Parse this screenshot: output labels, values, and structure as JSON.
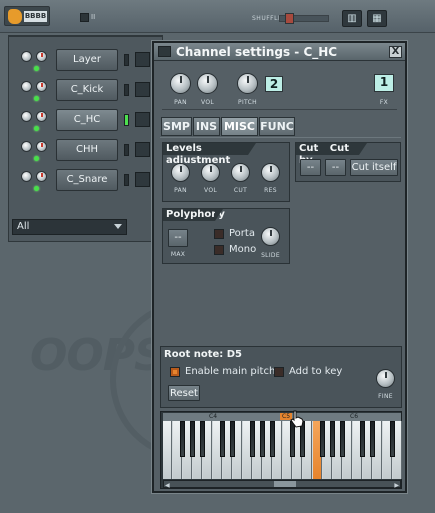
{
  "topbar": {
    "logo_lcd": "BBBB",
    "small_text": "II",
    "shuffle_label": "SHUFFLE"
  },
  "rack": {
    "channels": [
      {
        "label": "Layer",
        "selected": false,
        "led": false
      },
      {
        "label": "C_Kick",
        "selected": false,
        "led": false
      },
      {
        "label": "C_HC",
        "selected": true,
        "led": true
      },
      {
        "label": "CHH",
        "selected": false,
        "led": false
      },
      {
        "label": "C_Snare",
        "selected": false,
        "led": false
      }
    ],
    "filter_value": "All"
  },
  "background_text": "OOPS",
  "channel_window": {
    "title": "Channel settings - C_HC",
    "close_glyph": "X",
    "top_controls": {
      "pan_label": "PAN",
      "vol_label": "VOL",
      "pitch_label": "PITCH",
      "pitch_value": "2",
      "fx_label": "FX",
      "fx_value": "1"
    },
    "tabs": [
      "SMP",
      "INS",
      "MISC",
      "FUNC"
    ],
    "active_tab": "MISC",
    "levels": {
      "title": "Levels adjustment",
      "knobs": [
        "PAN",
        "VOL",
        "CUT",
        "RES"
      ]
    },
    "cut": {
      "title": "Cut",
      "cut_by_title": "Cut by",
      "cut_value": "--",
      "cut_by_value": "--",
      "cut_itself_label": "Cut itself"
    },
    "polyphony": {
      "title": "Polyphony",
      "max_value": "--",
      "max_label": "MAX",
      "porta_label": "Porta",
      "mono_label": "Mono",
      "slide_label": "SLIDE"
    },
    "root_note": {
      "title": "Root note: D5",
      "enable_main_pitch_label": "Enable main pitch",
      "enable_main_pitch_checked": true,
      "add_to_key_label": "Add to key",
      "add_to_key_checked": false,
      "reset_label": "Reset",
      "fine_label": "FINE"
    },
    "keyboard": {
      "octave_labels": [
        "C4",
        "C5",
        "C6"
      ],
      "highlighted_key": "D5"
    }
  },
  "colors": {
    "accent_orange": "#e6842e",
    "led_green": "#4de04f",
    "lcd_cyan": "#bdeee6"
  }
}
